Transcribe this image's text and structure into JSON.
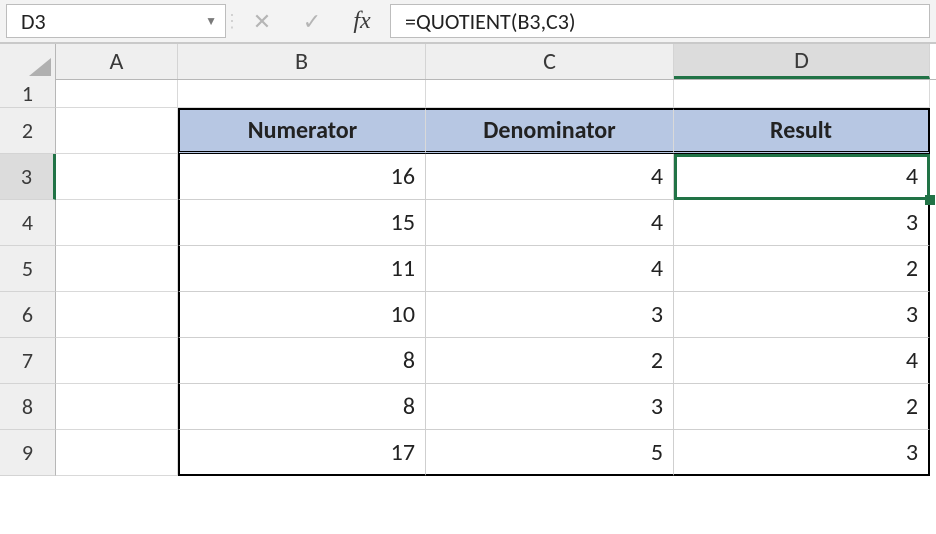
{
  "formula_bar": {
    "namebox": "D3",
    "cancel_icon": "✕",
    "enter_icon": "✓",
    "fx_label": "fx",
    "formula": "=QUOTIENT(B3,C3)"
  },
  "columns": {
    "A": "A",
    "B": "B",
    "C": "C",
    "D": "D"
  },
  "row_nums": {
    "r1": "1",
    "r2": "2",
    "r3": "3",
    "r4": "4",
    "r5": "5",
    "r6": "6",
    "r7": "7",
    "r8": "8",
    "r9": "9"
  },
  "headers": {
    "b": "Numerator",
    "c": "Denominator",
    "d": "Result"
  },
  "active": {
    "col": "D",
    "row": 3
  },
  "rows": [
    {
      "b": "16",
      "c": "4",
      "d": "4"
    },
    {
      "b": "15",
      "c": "4",
      "d": "3"
    },
    {
      "b": "11",
      "c": "4",
      "d": "2"
    },
    {
      "b": "10",
      "c": "3",
      "d": "3"
    },
    {
      "b": "8",
      "c": "2",
      "d": "4"
    },
    {
      "b": "8",
      "c": "3",
      "d": "2"
    },
    {
      "b": "17",
      "c": "5",
      "d": "3"
    }
  ]
}
